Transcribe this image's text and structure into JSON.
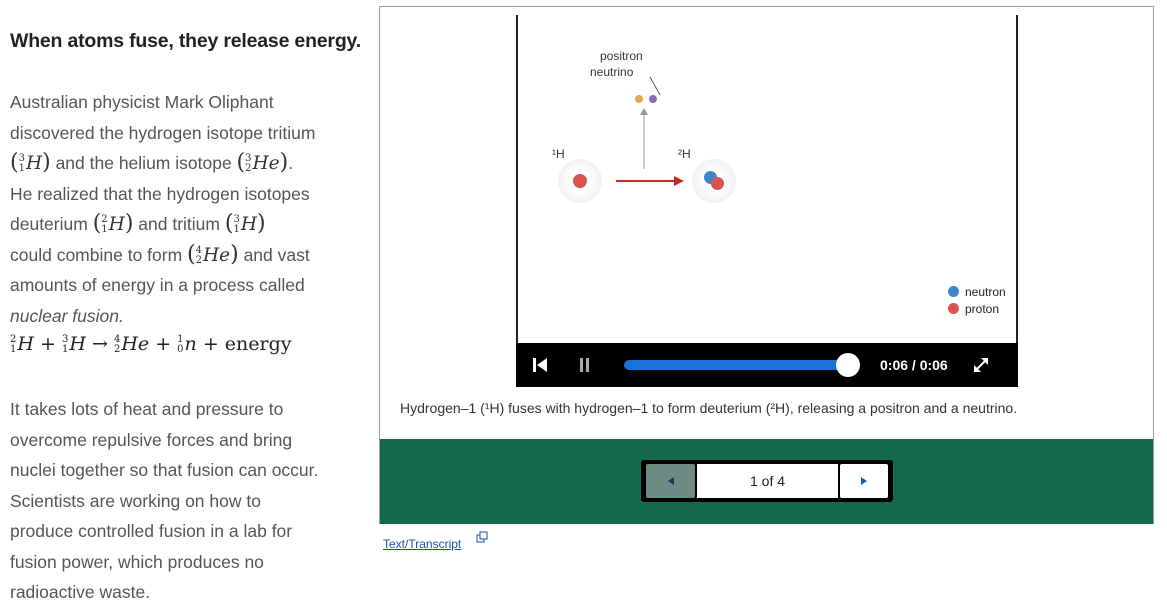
{
  "left": {
    "heading": "When atoms fuse, they release energy.",
    "para1": {
      "line1": "Australian physicist Mark Oliphant",
      "line2": "discovered the hydrogen isotope tritium",
      "and_helium": "and the helium isotope",
      "line4": "He realized that the hydrogen isotopes",
      "deuterium": "deuterium",
      "and_tritium": "and tritium",
      "combine": "could combine to form",
      "and_vast": "and vast",
      "line7": "amounts of energy in a process called",
      "nuclear_fusion": "nuclear fusion."
    },
    "isotopes": {
      "tritium": {
        "mass": "3",
        "atomic": "1",
        "symbol": "H"
      },
      "helium3": {
        "mass": "3",
        "atomic": "2",
        "symbol": "He"
      },
      "deuterium": {
        "mass": "2",
        "atomic": "1",
        "symbol": "H"
      },
      "helium4": {
        "mass": "4",
        "atomic": "2",
        "symbol": "He"
      }
    },
    "equation": {
      "term1": {
        "mass": "2",
        "atomic": "1",
        "symbol": "H"
      },
      "term2": {
        "mass": "3",
        "atomic": "1",
        "symbol": "H"
      },
      "product1": {
        "mass": "4",
        "atomic": "2",
        "symbol": "He"
      },
      "product2": {
        "mass": "1",
        "atomic": "0",
        "symbol": "n"
      },
      "plus": "+",
      "arrow": "→",
      "energy": "energy"
    },
    "para2": [
      "It takes lots of heat and pressure to",
      "overcome repulsive forces and bring",
      "nuclei together so that fusion can occur.",
      "Scientists are working on how to",
      "produce controlled fusion in a lab for",
      "fusion power, which produces no",
      "radioactive waste."
    ]
  },
  "animation": {
    "positron_label": "positron",
    "neutrino_label": "neutrino",
    "h1_label": "¹H",
    "h2_label": "²H",
    "legend": [
      {
        "label": "neutron",
        "color": "#3f86c9"
      },
      {
        "label": "proton",
        "color": "#d9534f"
      }
    ],
    "colors": {
      "positron": "#e0a94a",
      "neutrino": "#8e6bb0",
      "arrow": "#c62828"
    }
  },
  "player": {
    "time": "0:06 / 0:06",
    "progress": 1.0,
    "restart_icon": "skip-back-icon",
    "pause_icon": "pause-icon",
    "fullscreen_icon": "expand-icon"
  },
  "caption": "Hydrogen–1 (¹H) fuses with hydrogen–1 to form deuterium (²H), releasing a positron and a neutrino.",
  "nav": {
    "page_label": "1 of 4",
    "prev_icon": "triangle-left-icon",
    "next_icon": "triangle-right-icon"
  },
  "transcript_link": "Text/Transcript",
  "colors": {
    "nav_bg": "#136a4e",
    "progress": "#1a73d6",
    "link": "#1d4f9e"
  }
}
